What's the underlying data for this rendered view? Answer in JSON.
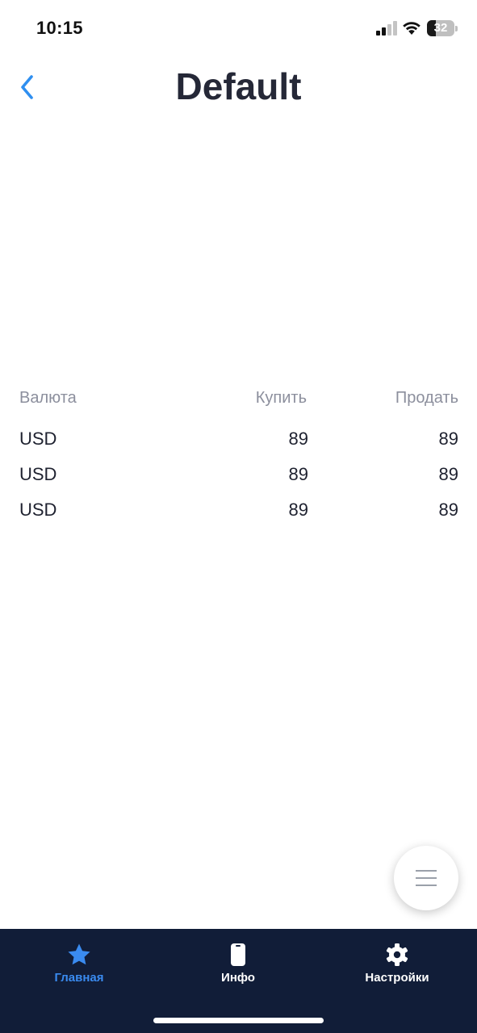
{
  "status_bar": {
    "time": "10:15",
    "battery_level": "32",
    "battery_fraction": 0.32
  },
  "header": {
    "title": "Default",
    "back_icon": "chevron-left-icon",
    "accent_color": "#2f8ff0"
  },
  "rates": {
    "columns": [
      "Валюта",
      "Купить",
      "Продать"
    ],
    "rows": [
      {
        "currency": "USD",
        "buy": "89",
        "sell": "89"
      },
      {
        "currency": "USD",
        "buy": "89",
        "sell": "89"
      },
      {
        "currency": "USD",
        "buy": "89",
        "sell": "89"
      }
    ]
  },
  "fab": {
    "icon": "menu-icon"
  },
  "tab_bar": {
    "background": "#111d38",
    "active_color": "#3a8bf0",
    "tabs": [
      {
        "label": "Главная",
        "icon": "star-icon",
        "active": true
      },
      {
        "label": "Инфо",
        "icon": "phone-icon",
        "active": false
      },
      {
        "label": "Настройки",
        "icon": "gear-icon",
        "active": false
      }
    ]
  }
}
